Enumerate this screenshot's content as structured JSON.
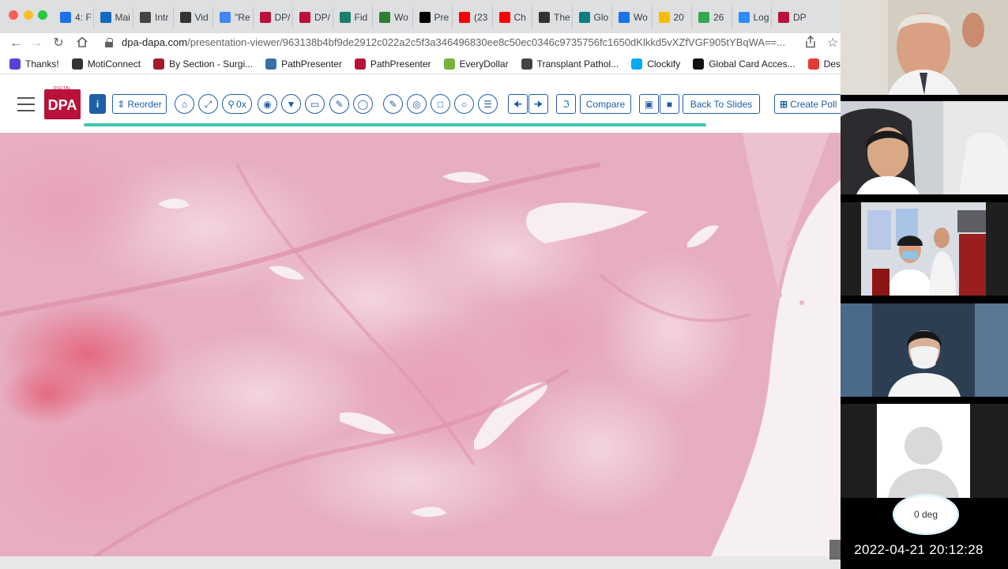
{
  "browser": {
    "tabs": [
      {
        "label": "4: F",
        "favicon": "blue-square",
        "color": "#1a73e8"
      },
      {
        "label": "Mai",
        "favicon": "outlook",
        "color": "#0f6cbd"
      },
      {
        "label": "Intr",
        "favicon": "globe",
        "color": "#444444"
      },
      {
        "label": "Vid",
        "favicon": "dark-square",
        "color": "#333333"
      },
      {
        "label": "\"Re",
        "favicon": "docs",
        "color": "#4285f4"
      },
      {
        "label": "DP/",
        "favicon": "dpa",
        "color": "#b8123a"
      },
      {
        "label": "DP/",
        "favicon": "dpa",
        "color": "#b8123a"
      },
      {
        "label": "Fid",
        "favicon": "teal-circle",
        "color": "#1b7f6b"
      },
      {
        "label": "Wo",
        "favicon": "sheets",
        "color": "#2e7d32"
      },
      {
        "label": "Pre",
        "favicon": "active-tab",
        "color": "#000000"
      },
      {
        "label": "(23",
        "favicon": "youtube",
        "color": "#ff0000"
      },
      {
        "label": "Ch",
        "favicon": "youtube",
        "color": "#ff0000"
      },
      {
        "label": "The",
        "favicon": "play",
        "color": "#333333"
      },
      {
        "label": "Glo",
        "favicon": "teal-square",
        "color": "#0e7c86"
      },
      {
        "label": "Wo",
        "favicon": "blue-square",
        "color": "#1a73e8"
      },
      {
        "label": "20",
        "favicon": "drive",
        "color": "#fbbc04"
      },
      {
        "label": "26",
        "favicon": "maps",
        "color": "#34a853"
      },
      {
        "label": "Log",
        "favicon": "zoom",
        "color": "#2d8cff"
      },
      {
        "label": "DP",
        "favicon": "dpa",
        "color": "#b8123a"
      }
    ],
    "url_host": "dpa-dapa.com",
    "url_path": "/presentation-viewer/963138b4bf9de2912c022a2c5f3a346496830ee8c50ec0346c9735756fc1650dKlkkd5vXZfVGF905tYBqWA==...",
    "bookmarks": [
      {
        "label": "Thanks!",
        "icon": "grid-icon",
        "color": "#5b3fd6"
      },
      {
        "label": "MotiConnect",
        "icon": "moti-icon",
        "color": "#333333"
      },
      {
        "label": "By Section - Surgi...",
        "icon": "shield-icon",
        "color": "#a6192e"
      },
      {
        "label": "PathPresenter",
        "icon": "path-icon",
        "color": "#3a6ea5"
      },
      {
        "label": "PathPresenter",
        "icon": "dpa-icon",
        "color": "#b8123a"
      },
      {
        "label": "EveryDollar",
        "icon": "dollar-icon",
        "color": "#74b43c"
      },
      {
        "label": "Transplant Pathol...",
        "icon": "globe-icon",
        "color": "#444444"
      },
      {
        "label": "Clockify",
        "icon": "clockify-icon",
        "color": "#03a9f4"
      },
      {
        "label": "Global Card Acces...",
        "icon": "card-icon",
        "color": "#111111"
      },
      {
        "label": "Descriptive ar",
        "icon": "descriptive-icon",
        "color": "#e53935"
      }
    ]
  },
  "viewer": {
    "logo_text": "DPA",
    "logo_subtext": "DIGITAL PATHOLOGY",
    "reorder_label": "Reorder",
    "zoom_label": "0x",
    "compare_label": "Compare",
    "back_label": "Back To Slides",
    "poll_label": "Create Poll",
    "progress_percent": 84,
    "accent_color": "#1f5fa8",
    "progress_color": "#3ec9b0"
  },
  "video": {
    "rotation_label": "0 deg",
    "timestamp": "2022-04-21  20:12:28"
  }
}
